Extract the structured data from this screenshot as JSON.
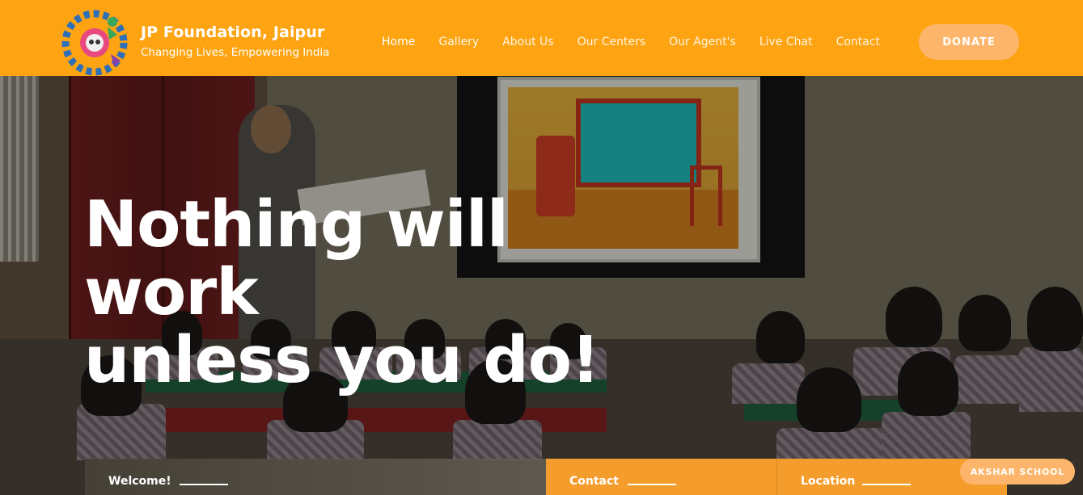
{
  "brand": {
    "title": "JP Foundation, Jaipur",
    "tagline": "Changing Lives, Empowering India"
  },
  "nav": {
    "items": [
      {
        "label": "Home",
        "active": true
      },
      {
        "label": "Gallery",
        "active": false
      },
      {
        "label": "About Us",
        "active": false
      },
      {
        "label": "Our Centers",
        "active": false
      },
      {
        "label": "Our Agent's",
        "active": false
      },
      {
        "label": "Live Chat",
        "active": false
      },
      {
        "label": "Contact",
        "active": false
      }
    ],
    "donate_label": "DONATE"
  },
  "hero": {
    "line1": "Nothing will work",
    "line2": "unless you do!"
  },
  "cards": {
    "welcome": "Welcome!",
    "contact": "Contact",
    "location": "Location"
  },
  "floating_button": "AKSHAR SCHOOL",
  "colors": {
    "header_bg": "#fea412",
    "button_bg": "#fdb56b",
    "card_bg": "#f49d2c"
  },
  "icons": {
    "logo": "foundation-gear-logo"
  }
}
